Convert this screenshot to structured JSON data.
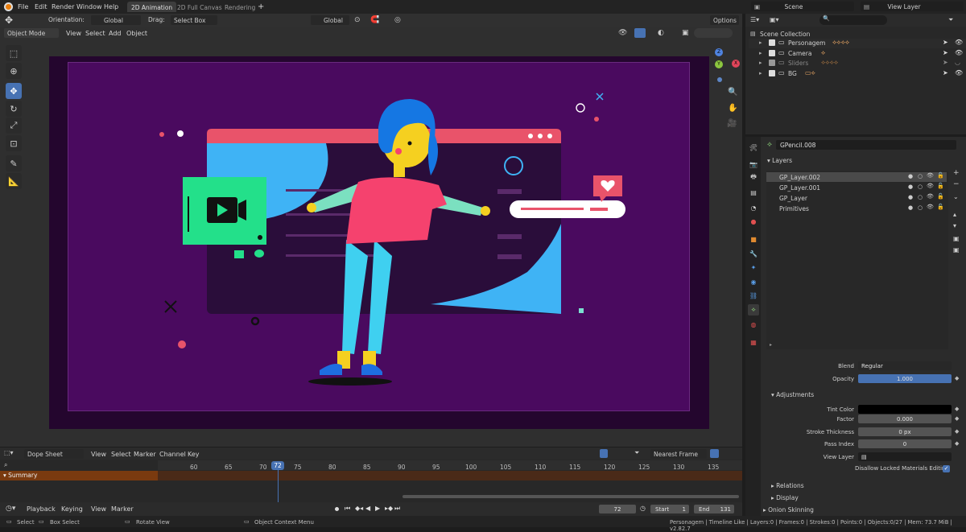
{
  "menu": {
    "items": [
      "File",
      "Edit",
      "Render",
      "Window",
      "Help"
    ],
    "tabs": [
      "2D Animation",
      "2D Full Canvas",
      "Rendering"
    ],
    "add_tab": "+",
    "scene": "Scene",
    "view_layer": "View Layer"
  },
  "toolbar": {
    "orientation_label": "Orientation:",
    "orientation_value": "Global",
    "drag_label": "Drag:",
    "drag_value": "Select Box",
    "transform_orient": "Global",
    "options": "Options"
  },
  "viewport_header": {
    "mode": "Object Mode",
    "menus": [
      "View",
      "Select",
      "Add",
      "Object"
    ]
  },
  "gizmo": {
    "x": "X",
    "y": "Y",
    "z": "Z"
  },
  "outliner": {
    "title": "Scene Collection",
    "items": [
      {
        "name": "Personagem"
      },
      {
        "name": "Camera"
      },
      {
        "name": "Sliders"
      },
      {
        "name": "BG"
      }
    ]
  },
  "properties": {
    "object_name": "GPencil.008",
    "layers_title": "Layers",
    "layers": [
      {
        "name": "GP_Layer.002",
        "active": true
      },
      {
        "name": "GP_Layer.001",
        "active": false
      },
      {
        "name": "GP_Layer",
        "active": false
      },
      {
        "name": "Primitives",
        "active": false
      }
    ],
    "blend_label": "Blend",
    "blend_value": "Regular",
    "opacity_label": "Opacity",
    "opacity_value": "1.000",
    "opacity_fill": 1.0,
    "adjustments_title": "Adjustments",
    "tint_color_label": "Tint Color",
    "factor_label": "Factor",
    "factor_value": "0.000",
    "stroke_label": "Stroke Thickness",
    "stroke_value": "0 px",
    "pass_index_label": "Pass Index",
    "pass_index_value": "0",
    "view_layer_label": "View Layer",
    "disallow_label": "Disallow Locked Materials Editing",
    "relations": "Relations",
    "display": "Display",
    "onion": "Onion Skinning"
  },
  "dopesheet": {
    "editor": "Dope Sheet",
    "menus": [
      "View",
      "Select",
      "Marker",
      "Channel",
      "Key"
    ],
    "snap": "Nearest Frame",
    "summary": "Summary",
    "frames": [
      "60",
      "65",
      "70",
      "75",
      "80",
      "85",
      "90",
      "95",
      "100",
      "105",
      "110",
      "115",
      "120",
      "125",
      "130",
      "135"
    ],
    "current_frame": "72"
  },
  "timeline": {
    "menus": [
      "Playback",
      "Keying",
      "View",
      "Marker"
    ],
    "frame": "72",
    "start_label": "Start",
    "start_value": "1",
    "end_label": "End",
    "end_value": "131"
  },
  "status": {
    "select": "Select",
    "box_select": "Box Select",
    "rotate_view": "Rotate View",
    "context_menu": "Object Context Menu",
    "info": "Personagem | Timeline Like | Layers:0 | Frames:0 | Strokes:0 | Points:0 | Objects:0/27 | Mem: 73.7 MiB | v2.82.7"
  },
  "colors": {
    "accent": "#4772b3",
    "canvas_bg": "#4a0a5f",
    "panel_bg": "#2b2b2b",
    "summary": "#7a3a0f",
    "heart": "#e8425a",
    "hair": "#1577e3"
  }
}
